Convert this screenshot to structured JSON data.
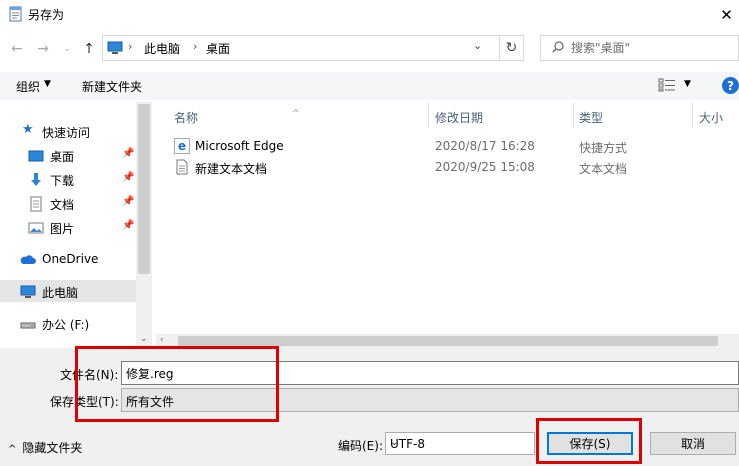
{
  "window": {
    "title": "另存为",
    "close_glyph": "✕"
  },
  "address": {
    "crumbs": [
      "此电脑",
      "桌面"
    ],
    "search_placeholder": "搜索\"桌面\""
  },
  "toolbar": {
    "organize": "组织",
    "new_folder": "新建文件夹"
  },
  "nav": {
    "quick_access": "快速访问",
    "items": [
      "桌面",
      "下载",
      "文档",
      "图片"
    ],
    "onedrive": "OneDrive",
    "this_pc": "此电脑",
    "drive": "办公 (F:)"
  },
  "columns": {
    "name": "名称",
    "modified": "修改日期",
    "type": "类型",
    "size": "大小"
  },
  "files": [
    {
      "name": "Microsoft Edge",
      "modified": "2020/8/17 16:28",
      "type": "快捷方式",
      "icon": "edge-shortcut-icon"
    },
    {
      "name": "新建文本文档",
      "modified": "2020/9/25 15:08",
      "type": "文本文档",
      "icon": "text-document-icon"
    }
  ],
  "form": {
    "filename_label": "文件名(N):",
    "filename_value": "修复.reg",
    "filetype_label": "保存类型(T):",
    "filetype_value": "所有文件",
    "hide_folders": "隐藏文件夹",
    "encoding_label": "编码(E):",
    "encoding_value": "UTF-8",
    "save": "保存(S)",
    "cancel": "取消"
  },
  "colors": {
    "accent": "#0078d7",
    "annotation": "#e00000",
    "selected": "#e5e5e5"
  }
}
